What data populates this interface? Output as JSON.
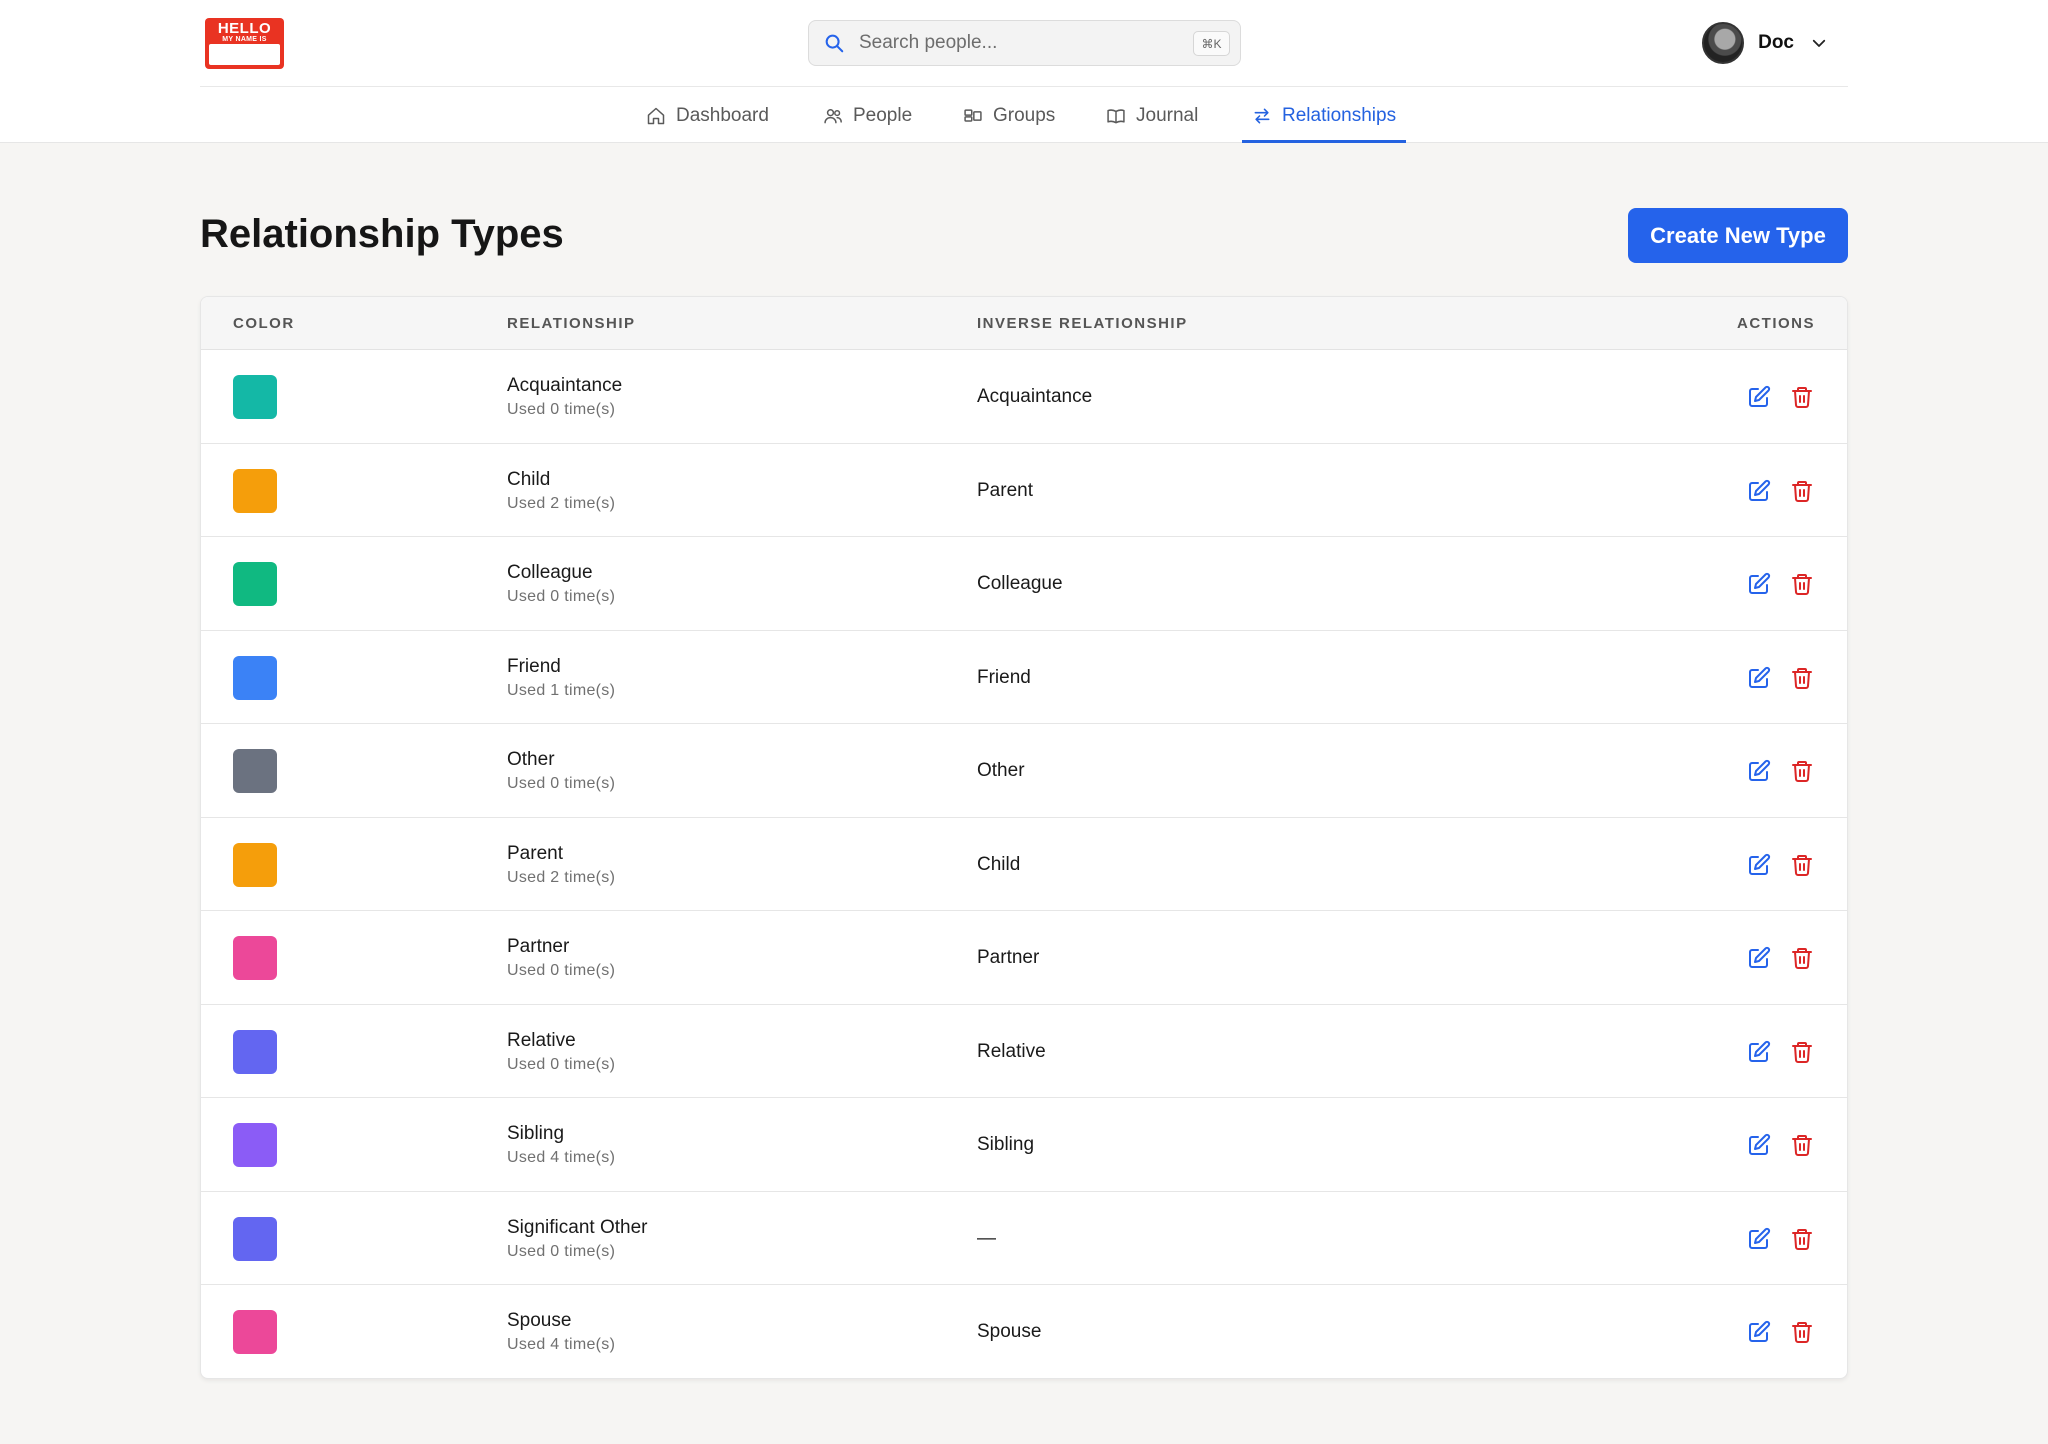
{
  "header": {
    "logo": {
      "line1": "HELLO",
      "line2": "MY NAME IS"
    },
    "search": {
      "placeholder": "Search people...",
      "shortcut": "⌘K"
    },
    "user": {
      "name": "Doc"
    }
  },
  "nav": {
    "items": [
      {
        "label": "Dashboard",
        "icon": "home-icon",
        "active": false
      },
      {
        "label": "People",
        "icon": "users-icon",
        "active": false
      },
      {
        "label": "Groups",
        "icon": "groups-icon",
        "active": false
      },
      {
        "label": "Journal",
        "icon": "book-icon",
        "active": false
      },
      {
        "label": "Relationships",
        "icon": "arrows-exchange-icon",
        "active": true
      }
    ]
  },
  "page": {
    "title": "Relationship Types",
    "create_button": "Create New Type"
  },
  "table": {
    "headers": {
      "color": "COLOR",
      "relationship": "RELATIONSHIP",
      "inverse": "INVERSE RELATIONSHIP",
      "actions": "ACTIONS"
    },
    "rows": [
      {
        "color": "#14b8a6",
        "name": "Acquaintance",
        "used": "Used 0 time(s)",
        "inverse": "Acquaintance"
      },
      {
        "color": "#f59e0b",
        "name": "Child",
        "used": "Used 2 time(s)",
        "inverse": "Parent"
      },
      {
        "color": "#10b981",
        "name": "Colleague",
        "used": "Used 0 time(s)",
        "inverse": "Colleague"
      },
      {
        "color": "#3b82f6",
        "name": "Friend",
        "used": "Used 1 time(s)",
        "inverse": "Friend"
      },
      {
        "color": "#6b7280",
        "name": "Other",
        "used": "Used 0 time(s)",
        "inverse": "Other"
      },
      {
        "color": "#f59e0b",
        "name": "Parent",
        "used": "Used 2 time(s)",
        "inverse": "Child"
      },
      {
        "color": "#ec4899",
        "name": "Partner",
        "used": "Used 0 time(s)",
        "inverse": "Partner"
      },
      {
        "color": "#6366f1",
        "name": "Relative",
        "used": "Used 0 time(s)",
        "inverse": "Relative"
      },
      {
        "color": "#8b5cf6",
        "name": "Sibling",
        "used": "Used 4 time(s)",
        "inverse": "Sibling"
      },
      {
        "color": "#6366f1",
        "name": "Significant Other",
        "used": "Used 0 time(s)",
        "inverse": "—"
      },
      {
        "color": "#ec4899",
        "name": "Spouse",
        "used": "Used 4 time(s)",
        "inverse": "Spouse"
      }
    ]
  },
  "colors": {
    "accent": "#2563eb",
    "delete": "#dc2626",
    "edit": "#2563eb"
  }
}
